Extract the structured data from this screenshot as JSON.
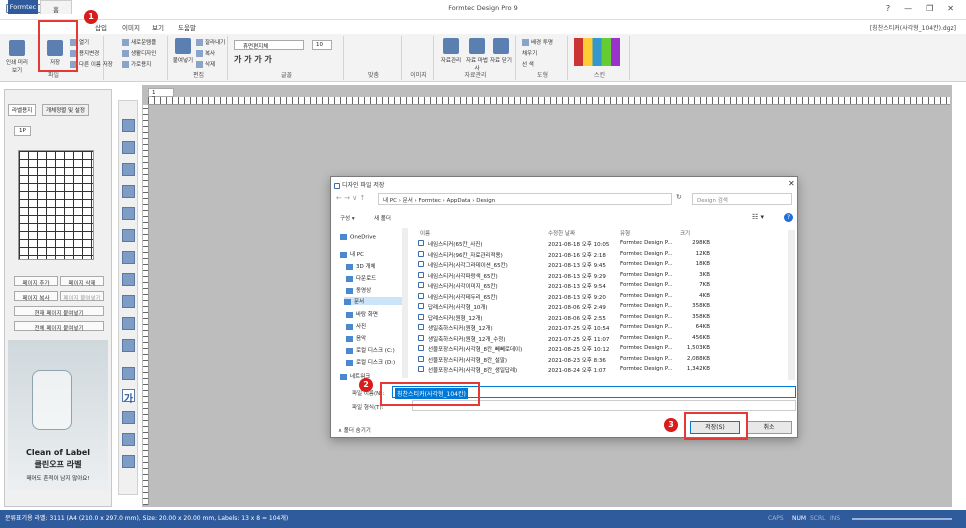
{
  "app": {
    "title": "Formtec Design Pro 9",
    "file_name": "[칭찬스티커(사각형_104칸).dgz]"
  },
  "window_controls": [
    "?",
    "—",
    "❐",
    "✕"
  ],
  "tabs": [
    "Formtec",
    "홈",
    "삽입",
    "이미지",
    "보기",
    "도움말"
  ],
  "ribbon": {
    "print_preview": "인쇄\n미리보기",
    "save": "저장",
    "open": "열기",
    "print_change": "용지변경",
    "save_as": "다른 이름 저장",
    "new_design": "새로운템플",
    "new_design2": "생활디자인",
    "horizontal": "가로용지",
    "paste": "붙여넣기",
    "cut": "잘라내기",
    "copy": "복사",
    "delete": "삭제",
    "font_name": "휴먼편지체",
    "font_size": "10",
    "group_labels": [
      "파일",
      "편집",
      "글꼴",
      "맞춤",
      "이미지",
      "자료관리",
      "도형",
      "스킨"
    ],
    "data_mgmt": "자료관리",
    "data_wizard": "자료\n마법사",
    "data_close": "자료\n닫기",
    "fill_color": "채우기",
    "line": "선 색",
    "bg_white": "배경 투명"
  },
  "left_panel": {
    "tabs": [
      "라벨용지",
      "개체정렬 및 설정"
    ],
    "page_tab": "1P",
    "buttons": [
      "페이지 추가",
      "페이지 삭제",
      "페이지 복사",
      "페이지 붙여넣기",
      "현재 페이지 붙여넣기",
      "전체 페이지 붙여넣기"
    ],
    "ad_title": "Clean of Label",
    "ad_sub": "클린오프 라벨",
    "ad_text": "떼어도 흔적이 남지 않아요!"
  },
  "canvas": {
    "page_tab": "1 Page"
  },
  "dialog": {
    "title": "디자인 파일 저장",
    "path": [
      "내 PC",
      "문서",
      "Formtec",
      "AppData",
      "Design"
    ],
    "search_placeholder": "Design 검색",
    "organize": "구성 ▾",
    "new_folder": "새 폴더",
    "columns": [
      "이름",
      "수정한 날짜",
      "유형",
      "크기"
    ],
    "nav": [
      "OneDrive",
      "내 PC",
      "3D 개체",
      "다운로드",
      "동영상",
      "문서",
      "바탕 화면",
      "사진",
      "음악",
      "로컬 디스크 (C:)",
      "로컬 디스크 (D:)",
      "네트워크"
    ],
    "files": [
      {
        "name": "네임스티커(65칸_사진)",
        "date": "2021-08-18 오후 10:05",
        "type": "Formtec Design P...",
        "size": "298KB"
      },
      {
        "name": "네임스티커(96칸_자료관리적용)",
        "date": "2021-08-16 오후 2:18",
        "type": "Formtec Design P...",
        "size": "12KB"
      },
      {
        "name": "네임스티커(사각그라데이션_65칸)",
        "date": "2021-08-13 오후 9:45",
        "type": "Formtec Design P...",
        "size": "18KB"
      },
      {
        "name": "네임스티커(사각파랑색_65칸)",
        "date": "2021-08-13 오후 9:29",
        "type": "Formtec Design P...",
        "size": "3KB"
      },
      {
        "name": "네임스티커(사각이미지_65칸)",
        "date": "2021-08-13 오후 9:54",
        "type": "Formtec Design P...",
        "size": "7KB"
      },
      {
        "name": "네임스티커(사각테두리_65칸)",
        "date": "2021-08-13 오후 9:20",
        "type": "Formtec Design P...",
        "size": "4KB"
      },
      {
        "name": "답례스티커(사각형_10개)",
        "date": "2021-08-06 오후 2:49",
        "type": "Formtec Design P...",
        "size": "358KB"
      },
      {
        "name": "답례스티커(원형_12개)",
        "date": "2021-08-06 오후 2:55",
        "type": "Formtec Design P...",
        "size": "358KB"
      },
      {
        "name": "생일축하스티커(원형_12개)",
        "date": "2021-07-25 오후 10:54",
        "type": "Formtec Design P...",
        "size": "64KB"
      },
      {
        "name": "생일축하스티커(원형_12개_수정)",
        "date": "2021-07-25 오후 11:07",
        "type": "Formtec Design P...",
        "size": "456KB"
      },
      {
        "name": "선물포장스티커(사각형_8칸_빼빼로데이)",
        "date": "2021-08-25 오후 10:12",
        "type": "Formtec Design P...",
        "size": "1,503KB"
      },
      {
        "name": "선물포장스티커(사각형_8칸_설말)",
        "date": "2021-08-23 오후 8:36",
        "type": "Formtec Design P...",
        "size": "2,088KB"
      },
      {
        "name": "선물포장스티커(사각형_8칸_생일답례)",
        "date": "2021-08-24 오후 1:07",
        "type": "Formtec Design P...",
        "size": "1,342KB"
      }
    ],
    "filename_label": "파일 이름(N):",
    "filename_value": "칭찬스티커(사각형_104칸)",
    "filetype_label": "파일 형식(T):",
    "hide_folders": "폴더 숨기기",
    "save_btn": "저장(S)",
    "cancel_btn": "취소"
  },
  "badges": [
    "1",
    "2",
    "3"
  ],
  "status": {
    "text": "분류표기용 라벨: 3111 (A4 (210.0 x 297.0 mm), Size: 20.00 x 20.00 mm, Labels: 13 x 8 = 104개)",
    "caps": "CAPS",
    "num": "NUM",
    "scrl": "SCRL",
    "ins": "INS"
  },
  "colors": {
    "accent": "#2f5a9b",
    "highlight": "#e53935"
  }
}
